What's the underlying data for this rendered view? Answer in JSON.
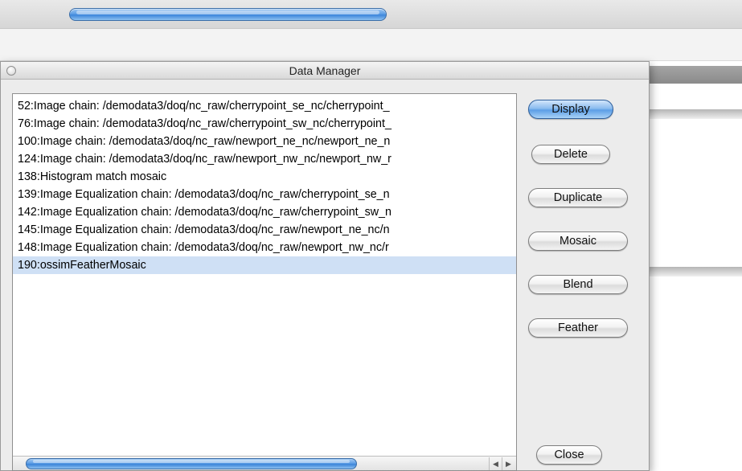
{
  "window": {
    "title": "Data Manager"
  },
  "list": {
    "items": [
      "52:Image chain: /demodata3/doq/nc_raw/cherrypoint_se_nc/cherrypoint_",
      "76:Image chain: /demodata3/doq/nc_raw/cherrypoint_sw_nc/cherrypoint_",
      "100:Image chain: /demodata3/doq/nc_raw/newport_ne_nc/newport_ne_n",
      "124:Image chain: /demodata3/doq/nc_raw/newport_nw_nc/newport_nw_r",
      "138:Histogram match mosaic",
      "139:Image Equalization chain: /demodata3/doq/nc_raw/cherrypoint_se_n",
      "142:Image Equalization chain: /demodata3/doq/nc_raw/cherrypoint_sw_n",
      "145:Image Equalization chain: /demodata3/doq/nc_raw/newport_ne_nc/n",
      "148:Image Equalization chain: /demodata3/doq/nc_raw/newport_nw_nc/r",
      "190:ossimFeatherMosaic"
    ],
    "selected_index": 9
  },
  "buttons": {
    "display": "Display",
    "delete": "Delete",
    "duplicate": "Duplicate",
    "mosaic": "Mosaic",
    "blend": "Blend",
    "feather": "Feather",
    "close": "Close"
  },
  "scroll": {
    "left_arrow": "◀",
    "right_arrow": "▶"
  },
  "colors": {
    "selection": "#cfe0f5",
    "accent_blue": "#5c9ee6"
  }
}
